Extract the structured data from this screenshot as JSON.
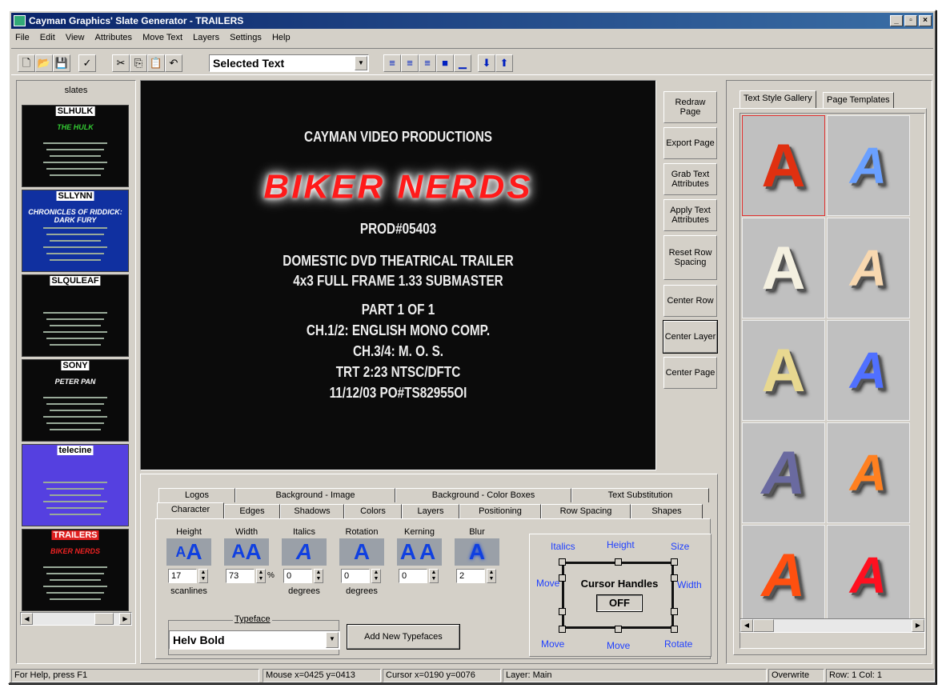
{
  "window": {
    "title": "Cayman Graphics' Slate Generator - TRAILERS"
  },
  "menu": [
    "File",
    "Edit",
    "View",
    "Attributes",
    "Move Text",
    "Layers",
    "Settings",
    "Help"
  ],
  "toolbar": {
    "text_selector": "Selected Text"
  },
  "slates": {
    "label": "slates",
    "items": [
      {
        "name": "SLHULK",
        "bg": "#0a0a0a",
        "headline": "THE HULK",
        "headline_color": "#3c3"
      },
      {
        "name": "SLLYNN",
        "bg": "#1030a0",
        "headline": "CHRONICLES OF RIDDICK: DARK FURY",
        "headline_color": "#fff"
      },
      {
        "name": "SLQULEAF",
        "bg": "#0a0a0a",
        "headline": "",
        "headline_color": "#fff"
      },
      {
        "name": "SONY",
        "bg": "#0a0a0a",
        "headline": "PETER PAN",
        "headline_color": "#fff"
      },
      {
        "name": "telecine",
        "bg": "#5540e0",
        "headline": "",
        "headline_color": "#fff"
      },
      {
        "name": "TRAILERS",
        "bg": "#0a0a0a",
        "headline": "BIKER NERDS",
        "headline_color": "#e22"
      }
    ]
  },
  "slate": {
    "line1": "CAYMAN VIDEO PRODUCTIONS",
    "title": "BIKER NERDS",
    "line3": "PROD#05403",
    "line4": "DOMESTIC DVD THEATRICAL TRAILER",
    "line5": "4x3 FULL FRAME 1.33 SUBMASTER",
    "line6": "PART 1 OF 1",
    "line7": "CH.1/2:  ENGLISH MONO COMP.",
    "line8": "CH.3/4: M. O. S.",
    "line9": "TRT 2:23    NTSC/DFTC",
    "line10": "11/12/03    PO#TS82955OI"
  },
  "side_buttons": {
    "redraw": "Redraw Page",
    "export": "Export Page",
    "grab": "Grab Text Attributes",
    "apply": "Apply Text Attributes",
    "reset": "Reset Row Spacing",
    "center_row": "Center Row",
    "center_layer": "Center Layer",
    "center_page": "Center Page"
  },
  "gallery": {
    "tab1": "Text Style Gallery",
    "tab2": "Page Templates",
    "styles": [
      "#e03010",
      "#6aa0ff",
      "#f4f0e0",
      "#f8d8b0",
      "#e8d890",
      "#5070ff",
      "#6a6aa0",
      "#ff8020",
      "#ff5010",
      "#ff1020"
    ]
  },
  "props": {
    "tabs_back": [
      "Logos",
      "Background - Image",
      "Background - Color Boxes",
      "Text Substitution"
    ],
    "tabs_front": [
      "Character",
      "Edges",
      "Shadows",
      "Colors",
      "Layers",
      "Positioning",
      "Row Spacing",
      "Shapes"
    ],
    "height": {
      "label": "Height",
      "value": "17",
      "unit": "scanlines"
    },
    "width": {
      "label": "Width",
      "value": "73",
      "unit": "%"
    },
    "italics": {
      "label": "Italics",
      "value": "0",
      "unit": "degrees"
    },
    "rotation": {
      "label": "Rotation",
      "value": "0",
      "unit": "degrees"
    },
    "kerning": {
      "label": "Kerning",
      "value": "0"
    },
    "blur": {
      "label": "Blur",
      "value": "2"
    },
    "typeface_label": "Typeface",
    "typeface_value": "Helv Bold",
    "add_typefaces": "Add New Typefaces"
  },
  "handles": {
    "italics": "Italics",
    "height": "Height",
    "size": "Size",
    "move_left": "Move",
    "width": "Width",
    "title": "Cursor Handles",
    "state": "OFF",
    "move_bl": "Move",
    "move_bm": "Move",
    "rotate": "Rotate"
  },
  "status": {
    "help": "For Help, press F1",
    "mouse": "Mouse x=0425  y=0413",
    "cursor": "Cursor x=0190  y=0076",
    "layer": "Layer: Main",
    "mode": "Overwrite",
    "rowcol": "Row: 1  Col: 1"
  }
}
